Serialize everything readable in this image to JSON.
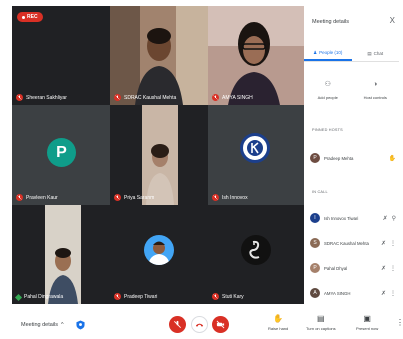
{
  "recording": {
    "label": "REC"
  },
  "tiles": {
    "t1": {
      "name": "Sheeran Sakhliyar"
    },
    "t2": {
      "name": "SDRAC Kaushal Mehta"
    },
    "t3": {
      "name": "AMYA SINGH"
    },
    "t4": {
      "name": "Pravleen Kaur",
      "initial": "P"
    },
    "t5": {
      "name": "Priya Saranm"
    },
    "t6": {
      "name": "Ish Innovox"
    },
    "t7": {
      "name": "Pahal Dingrawala"
    },
    "t8": {
      "name": "Pradeep Tiwari"
    },
    "t9": {
      "name": "Stuti Kary"
    }
  },
  "panel": {
    "title": "Meeting details",
    "close": "X",
    "tab_people": "People (10)",
    "tab_chat": "Chat",
    "add_people": "Add people",
    "host_controls": "Host controls",
    "pinned_label": "PINNED HOSTS",
    "pinned": [
      {
        "name": "Pradeep Mehta",
        "initial": "P"
      }
    ],
    "in_call_label": "IN CALL",
    "in_call": [
      {
        "name": "Ish Innovox Tiwari",
        "initial": "I"
      },
      {
        "name": "SDRAC Kaushal Mehta",
        "initial": "S"
      },
      {
        "name": "Pahal Dhyal",
        "initial": "P"
      },
      {
        "name": "AMYA SINGH",
        "initial": "A"
      }
    ]
  },
  "bottom": {
    "meeting_details": "Meeting details",
    "chevron": "^",
    "raise_hand": "Raise hand",
    "captions": "Turn on captions",
    "present": "Present now"
  },
  "colors": {
    "accent": "#1a73e8",
    "danger": "#d93025",
    "stage": "#202124",
    "tile": "#3c4043"
  }
}
